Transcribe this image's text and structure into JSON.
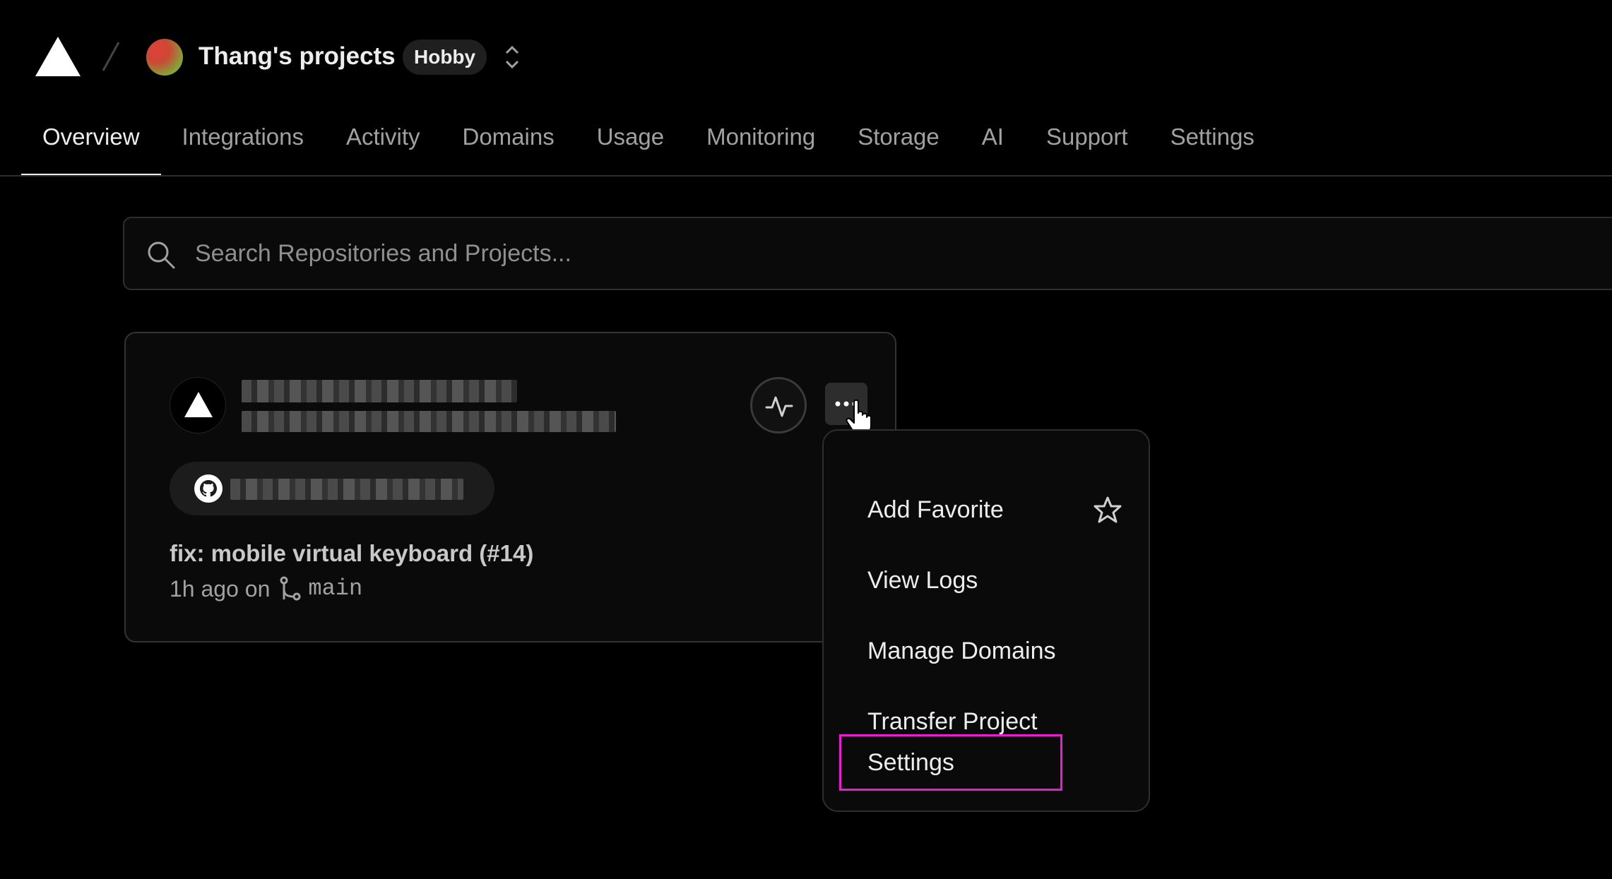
{
  "header": {
    "team_name": "Thang's projects",
    "plan_badge": "Hobby"
  },
  "tabs": [
    {
      "label": "Overview",
      "active": true
    },
    {
      "label": "Integrations"
    },
    {
      "label": "Activity"
    },
    {
      "label": "Domains"
    },
    {
      "label": "Usage"
    },
    {
      "label": "Monitoring"
    },
    {
      "label": "Storage"
    },
    {
      "label": "AI"
    },
    {
      "label": "Support"
    },
    {
      "label": "Settings"
    }
  ],
  "search": {
    "placeholder": "Search Repositories and Projects..."
  },
  "project_card": {
    "commit_message": "fix: mobile virtual keyboard (#14)",
    "commit_time": "1h ago on",
    "branch": "main"
  },
  "project_menu": {
    "items": [
      {
        "label": "Add Favorite",
        "icon": "star-icon"
      },
      {
        "label": "View Logs"
      },
      {
        "label": "Manage Domains"
      },
      {
        "label": "Transfer Project"
      },
      {
        "label": "Settings",
        "highlighted": true
      }
    ]
  },
  "colors": {
    "background": "#000000",
    "highlight_border": "#e91ed4",
    "text_primary": "#ededed",
    "text_muted": "#a1a1a1"
  }
}
